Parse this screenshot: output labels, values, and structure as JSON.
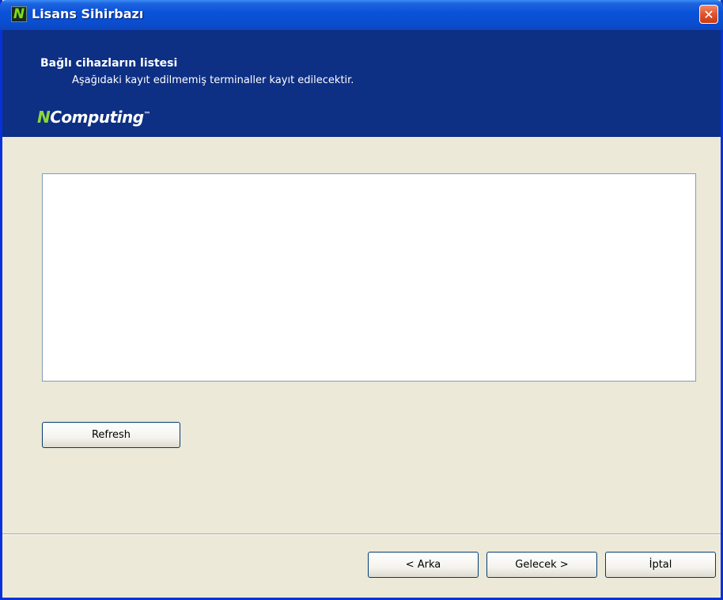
{
  "window": {
    "title": "Lisans Sihirbazı",
    "app_icon_glyph": "N",
    "close_glyph": "✕"
  },
  "header": {
    "title": "Bağlı cihazların listesi",
    "subtitle": "Aşağıdaki kayıt edilmemiş terminaller kayıt edilecektir.",
    "brand_n": "N",
    "brand_rest": "Computing",
    "brand_tm": "™"
  },
  "content": {
    "devices": [],
    "refresh_label": "Refresh"
  },
  "footer": {
    "back_label": "< Arka",
    "next_label": "Gelecek >",
    "cancel_label": "İptal"
  },
  "colors": {
    "titlebar": "#0a52d8",
    "header_bg": "#0d2f84",
    "dialog_bg": "#ece9d8",
    "brand_green": "#8cd63c",
    "close_red": "#e0542c"
  }
}
